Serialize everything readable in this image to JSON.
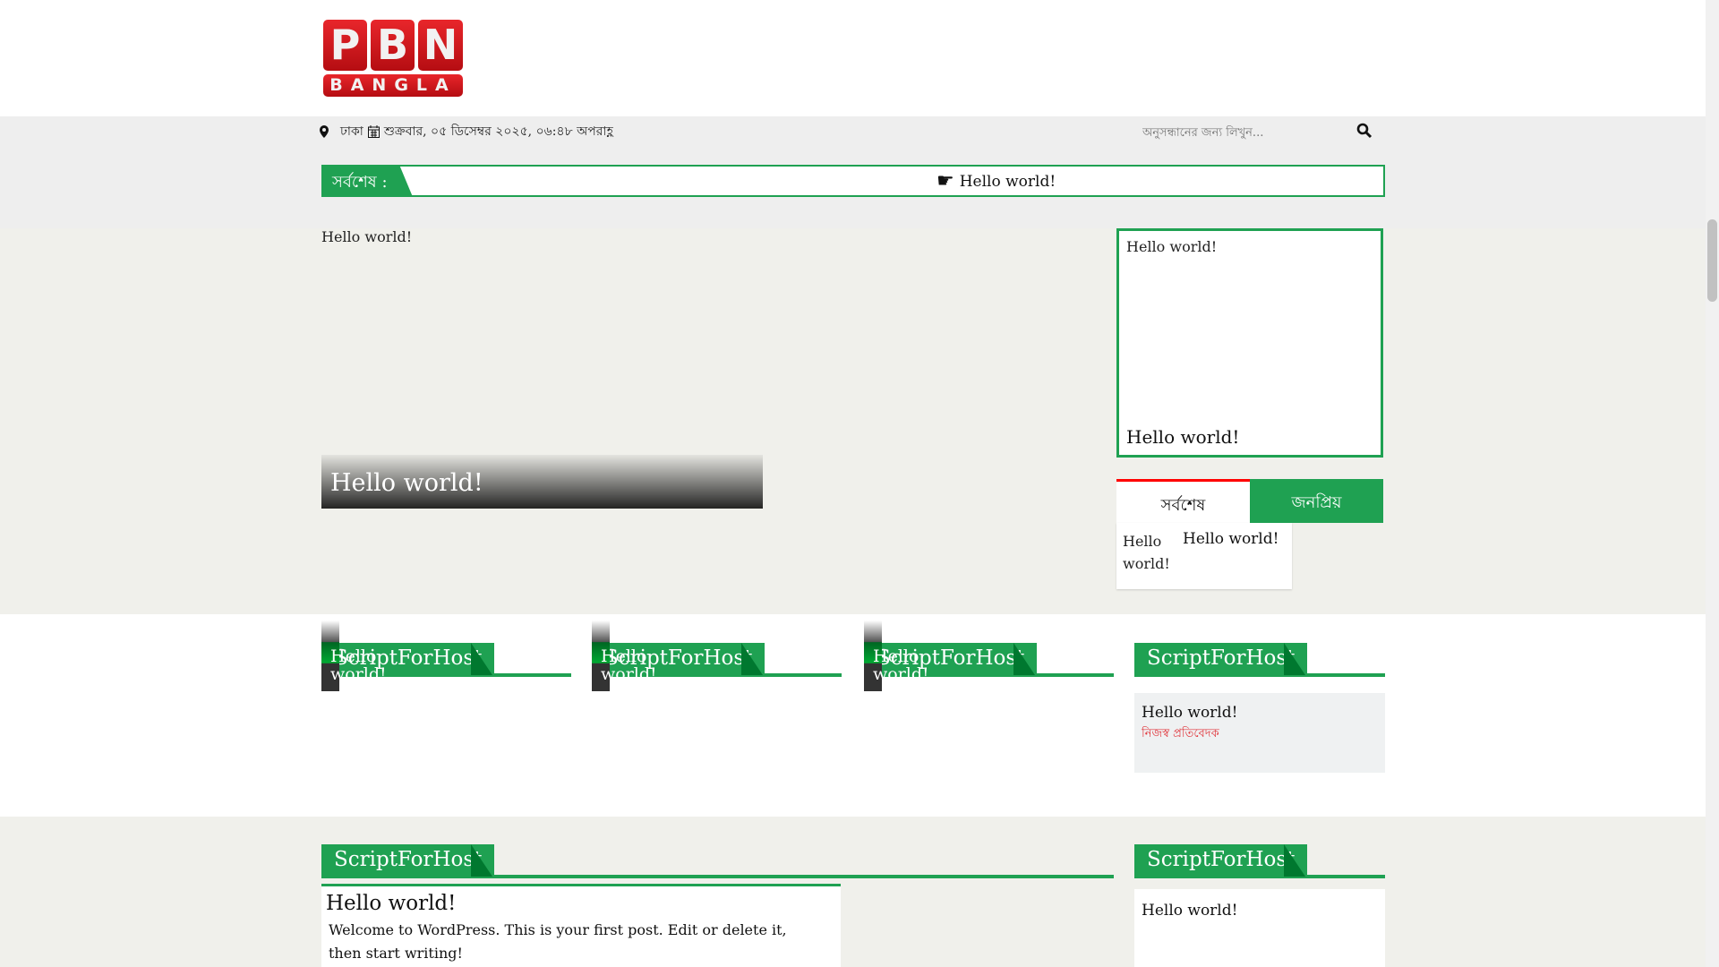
{
  "logo": {
    "line1": [
      "P",
      "B",
      "N"
    ],
    "line2": "BANGLA"
  },
  "topbar": {
    "location": "ঢাকা",
    "date": "শুক্রবার, ০৫ ডিসেম্বর ২০২৫, ০৬:৪৮ অপরাহ্ণ",
    "search_placeholder": "অনুসন্ধানের জন্য লিখুন..."
  },
  "ticker": {
    "label": "সর্বশেষ :",
    "item": "Hello world!"
  },
  "featured": {
    "img_alt": "Hello world!",
    "caption": "Hello world!"
  },
  "side_box": {
    "img_alt": "Hello world!",
    "title": "Hello world!"
  },
  "tabs": [
    {
      "label": "সর্বশেষ"
    },
    {
      "label": "জনপ্রিয়"
    }
  ],
  "tab_item": {
    "img_alt": "Hello world!",
    "title": "Hello world!"
  },
  "sections": [
    {
      "title": "ScriptForHost",
      "thumb_alt": "Hello world!"
    },
    {
      "title": "ScriptForHost",
      "thumb_alt": "Hello world!"
    },
    {
      "title": "ScriptForHost",
      "thumb_alt": "Hello world!"
    },
    {
      "title": "ScriptForHost",
      "post_title": "Hello world!",
      "author": "নিজস্ব প্রতিবেদক"
    }
  ],
  "bottom": {
    "left_title": "ScriptForHost",
    "right_title": "ScriptForHost",
    "post_title": "Hello world!",
    "post_excerpt": "Welcome to WordPress. This is your first post. Edit or delete it, then start writing!",
    "right_item": "Hello world!"
  },
  "colors": {
    "green": "#1fa152",
    "dark_green": "#00782f",
    "red": "#ff0000"
  }
}
